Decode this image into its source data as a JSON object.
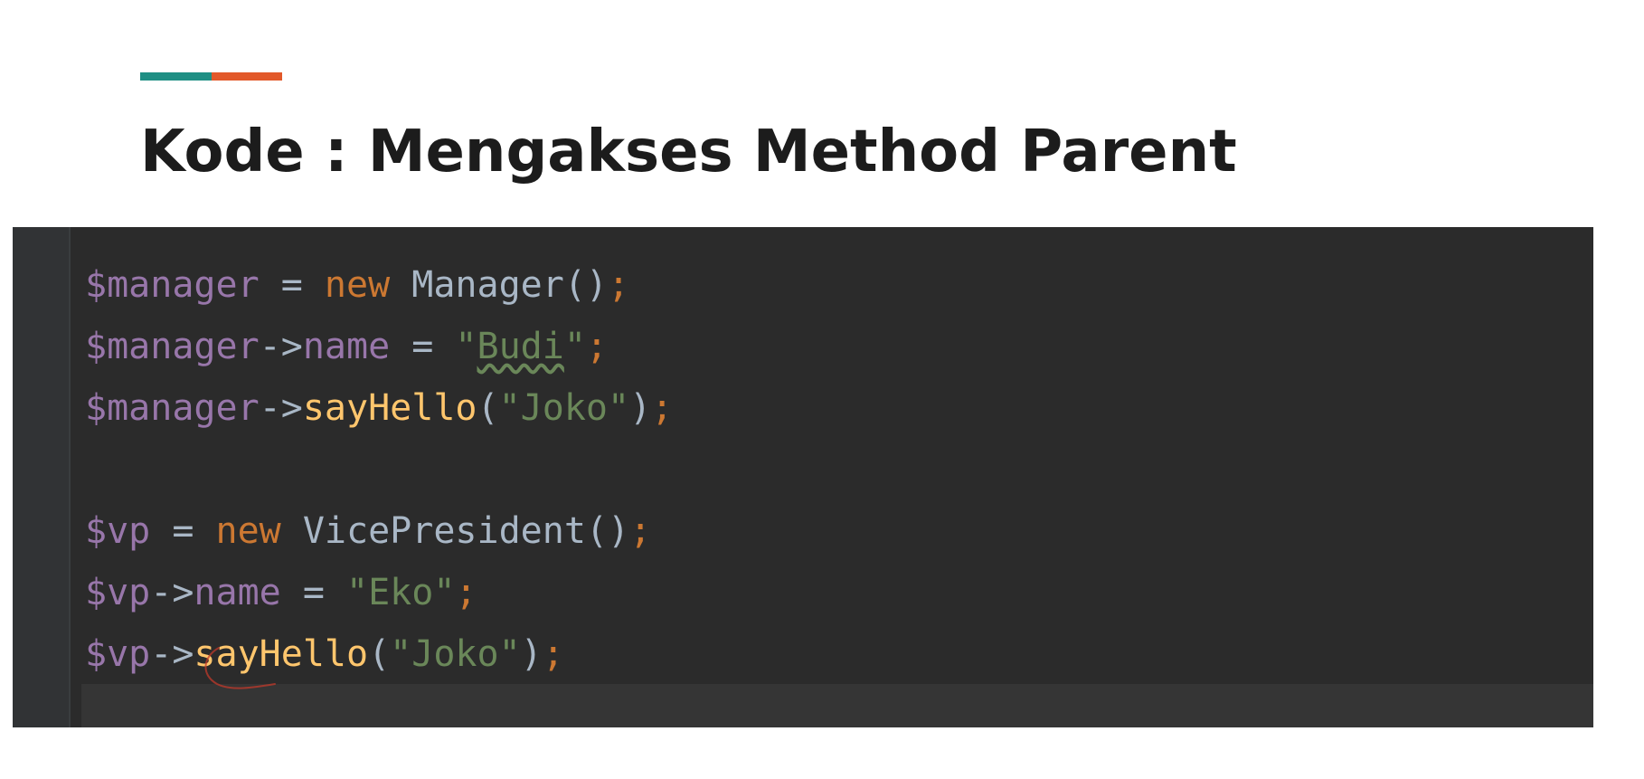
{
  "slide": {
    "title": "Kode : Mengakses Method Parent",
    "accent_colors": [
      "#1f8f84",
      "#e2592a"
    ]
  },
  "editor": {
    "background": "#2b2b2b",
    "lines": [
      [
        {
          "t": "$manager",
          "k": "var"
        },
        {
          "t": " = ",
          "k": "op"
        },
        {
          "t": "new",
          "k": "kw"
        },
        {
          "t": " Manager()",
          "k": "cls"
        },
        {
          "t": ";",
          "k": "semi"
        }
      ],
      [
        {
          "t": "$manager",
          "k": "var"
        },
        {
          "t": "->",
          "k": "op"
        },
        {
          "t": "name",
          "k": "prop"
        },
        {
          "t": " = ",
          "k": "op"
        },
        {
          "t": "\"",
          "k": "str"
        },
        {
          "t": "Budi",
          "k": "str-squiggle"
        },
        {
          "t": "\"",
          "k": "str"
        },
        {
          "t": ";",
          "k": "semi"
        }
      ],
      [
        {
          "t": "$manager",
          "k": "var"
        },
        {
          "t": "->",
          "k": "op"
        },
        {
          "t": "sayHello",
          "k": "method"
        },
        {
          "t": "(",
          "k": "punc"
        },
        {
          "t": "\"Joko\"",
          "k": "str"
        },
        {
          "t": ")",
          "k": "punc"
        },
        {
          "t": ";",
          "k": "semi"
        }
      ],
      [],
      [
        {
          "t": "$vp",
          "k": "var"
        },
        {
          "t": " = ",
          "k": "op"
        },
        {
          "t": "new",
          "k": "kw"
        },
        {
          "t": " VicePresident()",
          "k": "cls"
        },
        {
          "t": ";",
          "k": "semi"
        }
      ],
      [
        {
          "t": "$vp",
          "k": "var"
        },
        {
          "t": "->",
          "k": "op"
        },
        {
          "t": "name",
          "k": "prop"
        },
        {
          "t": " = ",
          "k": "op"
        },
        {
          "t": "\"Eko\"",
          "k": "str"
        },
        {
          "t": ";",
          "k": "semi"
        }
      ],
      [
        {
          "t": "$vp",
          "k": "var"
        },
        {
          "t": "->",
          "k": "op"
        },
        {
          "t": "sayHello",
          "k": "method"
        },
        {
          "t": "(",
          "k": "punc"
        },
        {
          "t": "\"Joko\"",
          "k": "str"
        },
        {
          "t": ")",
          "k": "punc"
        },
        {
          "t": ";",
          "k": "semi"
        }
      ]
    ]
  }
}
